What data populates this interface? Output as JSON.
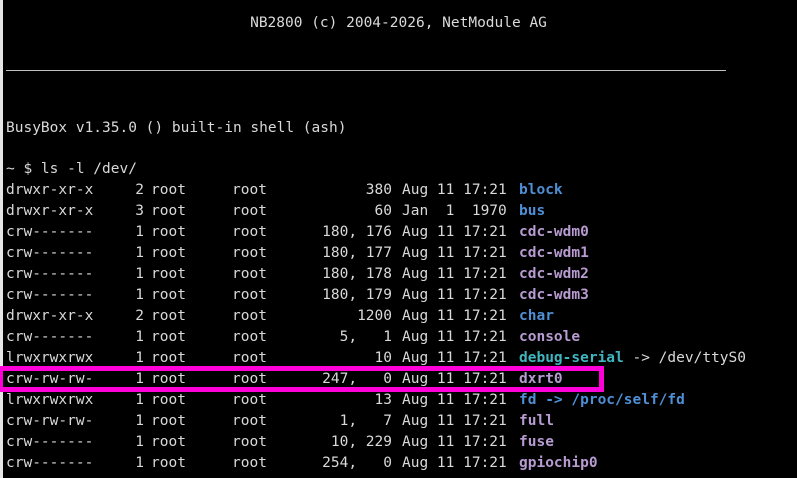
{
  "banner": "NB2800 (c) 2004-2026, NetModule AG",
  "shell_info": "BusyBox v1.35.0 () built-in shell (ash)",
  "prompt": "~ $ ls -l /dev/",
  "colors": {
    "directory": "#4f8fd6",
    "device": "#b79bd1",
    "symlink": "#3fb6c0",
    "highlight": "#ff00d8",
    "text": "#d9d9d9",
    "background": "#000000"
  },
  "listing": [
    {
      "perms": "drwxr-xr-x",
      "links": "2",
      "owner": "root",
      "group": "root",
      "size": "380",
      "date": "Aug 11 17:21",
      "name": "block",
      "type": "dir"
    },
    {
      "perms": "drwxr-xr-x",
      "links": "3",
      "owner": "root",
      "group": "root",
      "size": "60",
      "date": "Jan  1  1970",
      "name": "bus",
      "type": "dir"
    },
    {
      "perms": "crw-------",
      "links": "1",
      "owner": "root",
      "group": "root",
      "size": "180, 176",
      "date": "Aug 11 17:21",
      "name": "cdc-wdm0",
      "type": "dev"
    },
    {
      "perms": "crw-------",
      "links": "1",
      "owner": "root",
      "group": "root",
      "size": "180, 177",
      "date": "Aug 11 17:21",
      "name": "cdc-wdm1",
      "type": "dev"
    },
    {
      "perms": "crw-------",
      "links": "1",
      "owner": "root",
      "group": "root",
      "size": "180, 178",
      "date": "Aug 11 17:21",
      "name": "cdc-wdm2",
      "type": "dev"
    },
    {
      "perms": "crw-------",
      "links": "1",
      "owner": "root",
      "group": "root",
      "size": "180, 179",
      "date": "Aug 11 17:21",
      "name": "cdc-wdm3",
      "type": "dev"
    },
    {
      "perms": "drwxr-xr-x",
      "links": "2",
      "owner": "root",
      "group": "root",
      "size": "1200",
      "date": "Aug 11 17:21",
      "name": "char",
      "type": "dir"
    },
    {
      "perms": "crw-------",
      "links": "1",
      "owner": "root",
      "group": "root",
      "size": "5,   1",
      "date": "Aug 11 17:21",
      "name": "console",
      "type": "dev"
    },
    {
      "perms": "lrwxrwxrwx",
      "links": "1",
      "owner": "root",
      "group": "root",
      "size": "10",
      "date": "Aug 11 17:21",
      "name": "debug-serial",
      "target": " -> /dev/ttyS0",
      "type": "link"
    },
    {
      "perms": "crw-rw-rw-",
      "links": "1",
      "owner": "root",
      "group": "root",
      "size": "247,   0",
      "date": "Aug 11 17:21",
      "name": "dxrt0",
      "type": "dev"
    },
    {
      "perms": "lrwxrwxrwx",
      "links": "1",
      "owner": "root",
      "group": "root",
      "size": "13",
      "date": "Aug 11 17:21",
      "name": "fd",
      "target": " -> /proc/self/fd",
      "type": "dir"
    },
    {
      "perms": "crw-rw-rw-",
      "links": "1",
      "owner": "root",
      "group": "root",
      "size": "1,   7",
      "date": "Aug 11 17:21",
      "name": "full",
      "type": "dev"
    },
    {
      "perms": "crw-------",
      "links": "1",
      "owner": "root",
      "group": "root",
      "size": "10, 229",
      "date": "Aug 11 17:21",
      "name": "fuse",
      "type": "dev"
    },
    {
      "perms": "crw-------",
      "links": "1",
      "owner": "root",
      "group": "root",
      "size": "254,   0",
      "date": "Aug 11 17:21",
      "name": "gpiochip0",
      "type": "dev"
    }
  ]
}
